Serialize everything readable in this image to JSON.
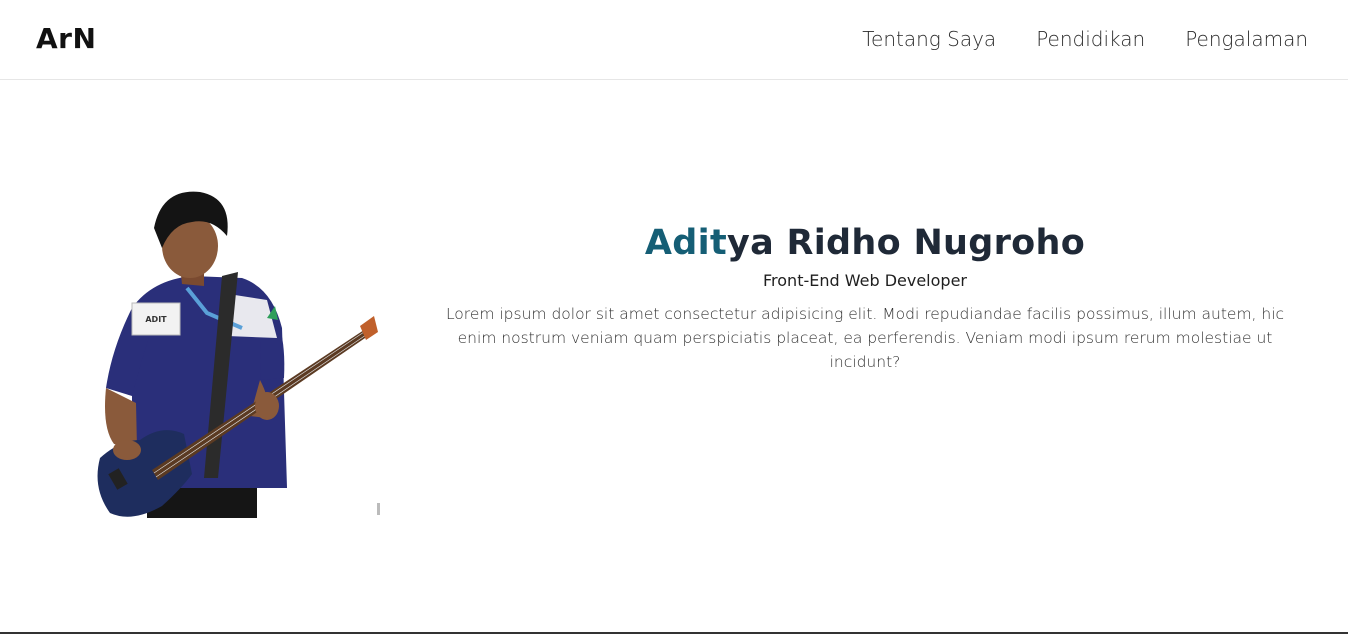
{
  "navbar": {
    "brand": "ArN",
    "links": [
      {
        "label": "Tentang Saya"
      },
      {
        "label": "Pendidikan"
      },
      {
        "label": "Pengalaman"
      }
    ]
  },
  "hero": {
    "name_accent": "Adit",
    "name_rest": "ya Ridho Nugroho",
    "role": "Front-End Web Developer",
    "description": "Lorem ipsum dolor sit amet consectetur adipisicing elit. Modi repudiandae facilis possimus, illum autem, hic enim nostrum veniam quam perspiciatis placeat, ea perferendis. Veniam modi ipsum rerum molestiae ut incidunt?",
    "photo": {
      "badge_text": "ADIT"
    }
  },
  "colors": {
    "accent": "#155e75",
    "name": "#1f2937",
    "shirt": "#2a2f7a",
    "guitar": "#1e2d5e"
  }
}
